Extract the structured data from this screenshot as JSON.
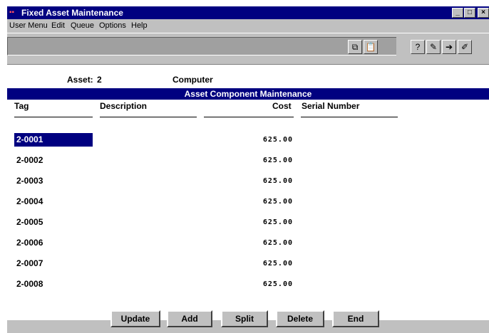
{
  "window": {
    "title": "Fixed Asset Maintenance",
    "controls": {
      "minimize": "_",
      "maximize": "□",
      "close": "×"
    }
  },
  "menu": [
    {
      "label": "User Menu"
    },
    {
      "label": "Edit"
    },
    {
      "label": "Queue"
    },
    {
      "label": "Options"
    },
    {
      "label": "Help"
    }
  ],
  "toolbar": {
    "icons": [
      "copy-icon",
      "paste-icon",
      "query-icon",
      "edit-icon",
      "export-icon",
      "pencil-icon"
    ]
  },
  "asset": {
    "label": "Asset:",
    "number": "2",
    "description": "Computer"
  },
  "section_title": "Asset Component Maintenance",
  "columns": {
    "tag": "Tag",
    "description": "Description",
    "cost": "Cost",
    "serial": "Serial Number"
  },
  "rows": [
    {
      "tag": "2-0001",
      "cost": "625.00",
      "selected": true
    },
    {
      "tag": "2-0002",
      "cost": "625.00"
    },
    {
      "tag": "2-0003",
      "cost": "625.00"
    },
    {
      "tag": "2-0004",
      "cost": "625.00"
    },
    {
      "tag": "2-0005",
      "cost": "625.00"
    },
    {
      "tag": "2-0006",
      "cost": "625.00"
    },
    {
      "tag": "2-0007",
      "cost": "625.00"
    },
    {
      "tag": "2-0008",
      "cost": "625.00"
    }
  ],
  "buttons": {
    "update": "Update",
    "add": "Add",
    "split": "Split",
    "delete": "Delete",
    "end": "End"
  },
  "colors": {
    "title_bar": "#000080",
    "selection": "#000080",
    "window_face": "#c0c0c0"
  }
}
